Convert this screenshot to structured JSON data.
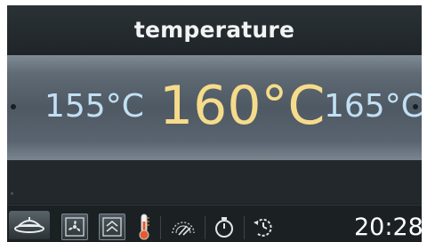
{
  "header": {
    "title": "temperature"
  },
  "selector": {
    "previous": "155°C",
    "current": "160°C",
    "next": "165°C",
    "accent_color": "#f6dc8a",
    "side_color": "#c2e0f4"
  },
  "footer": {
    "icons": [
      "tray-icon",
      "fan-icon",
      "heating-mode-icon",
      "thermometer-icon",
      "core-probe-icon",
      "timer-icon",
      "program-icon"
    ],
    "clock": "20:28"
  }
}
